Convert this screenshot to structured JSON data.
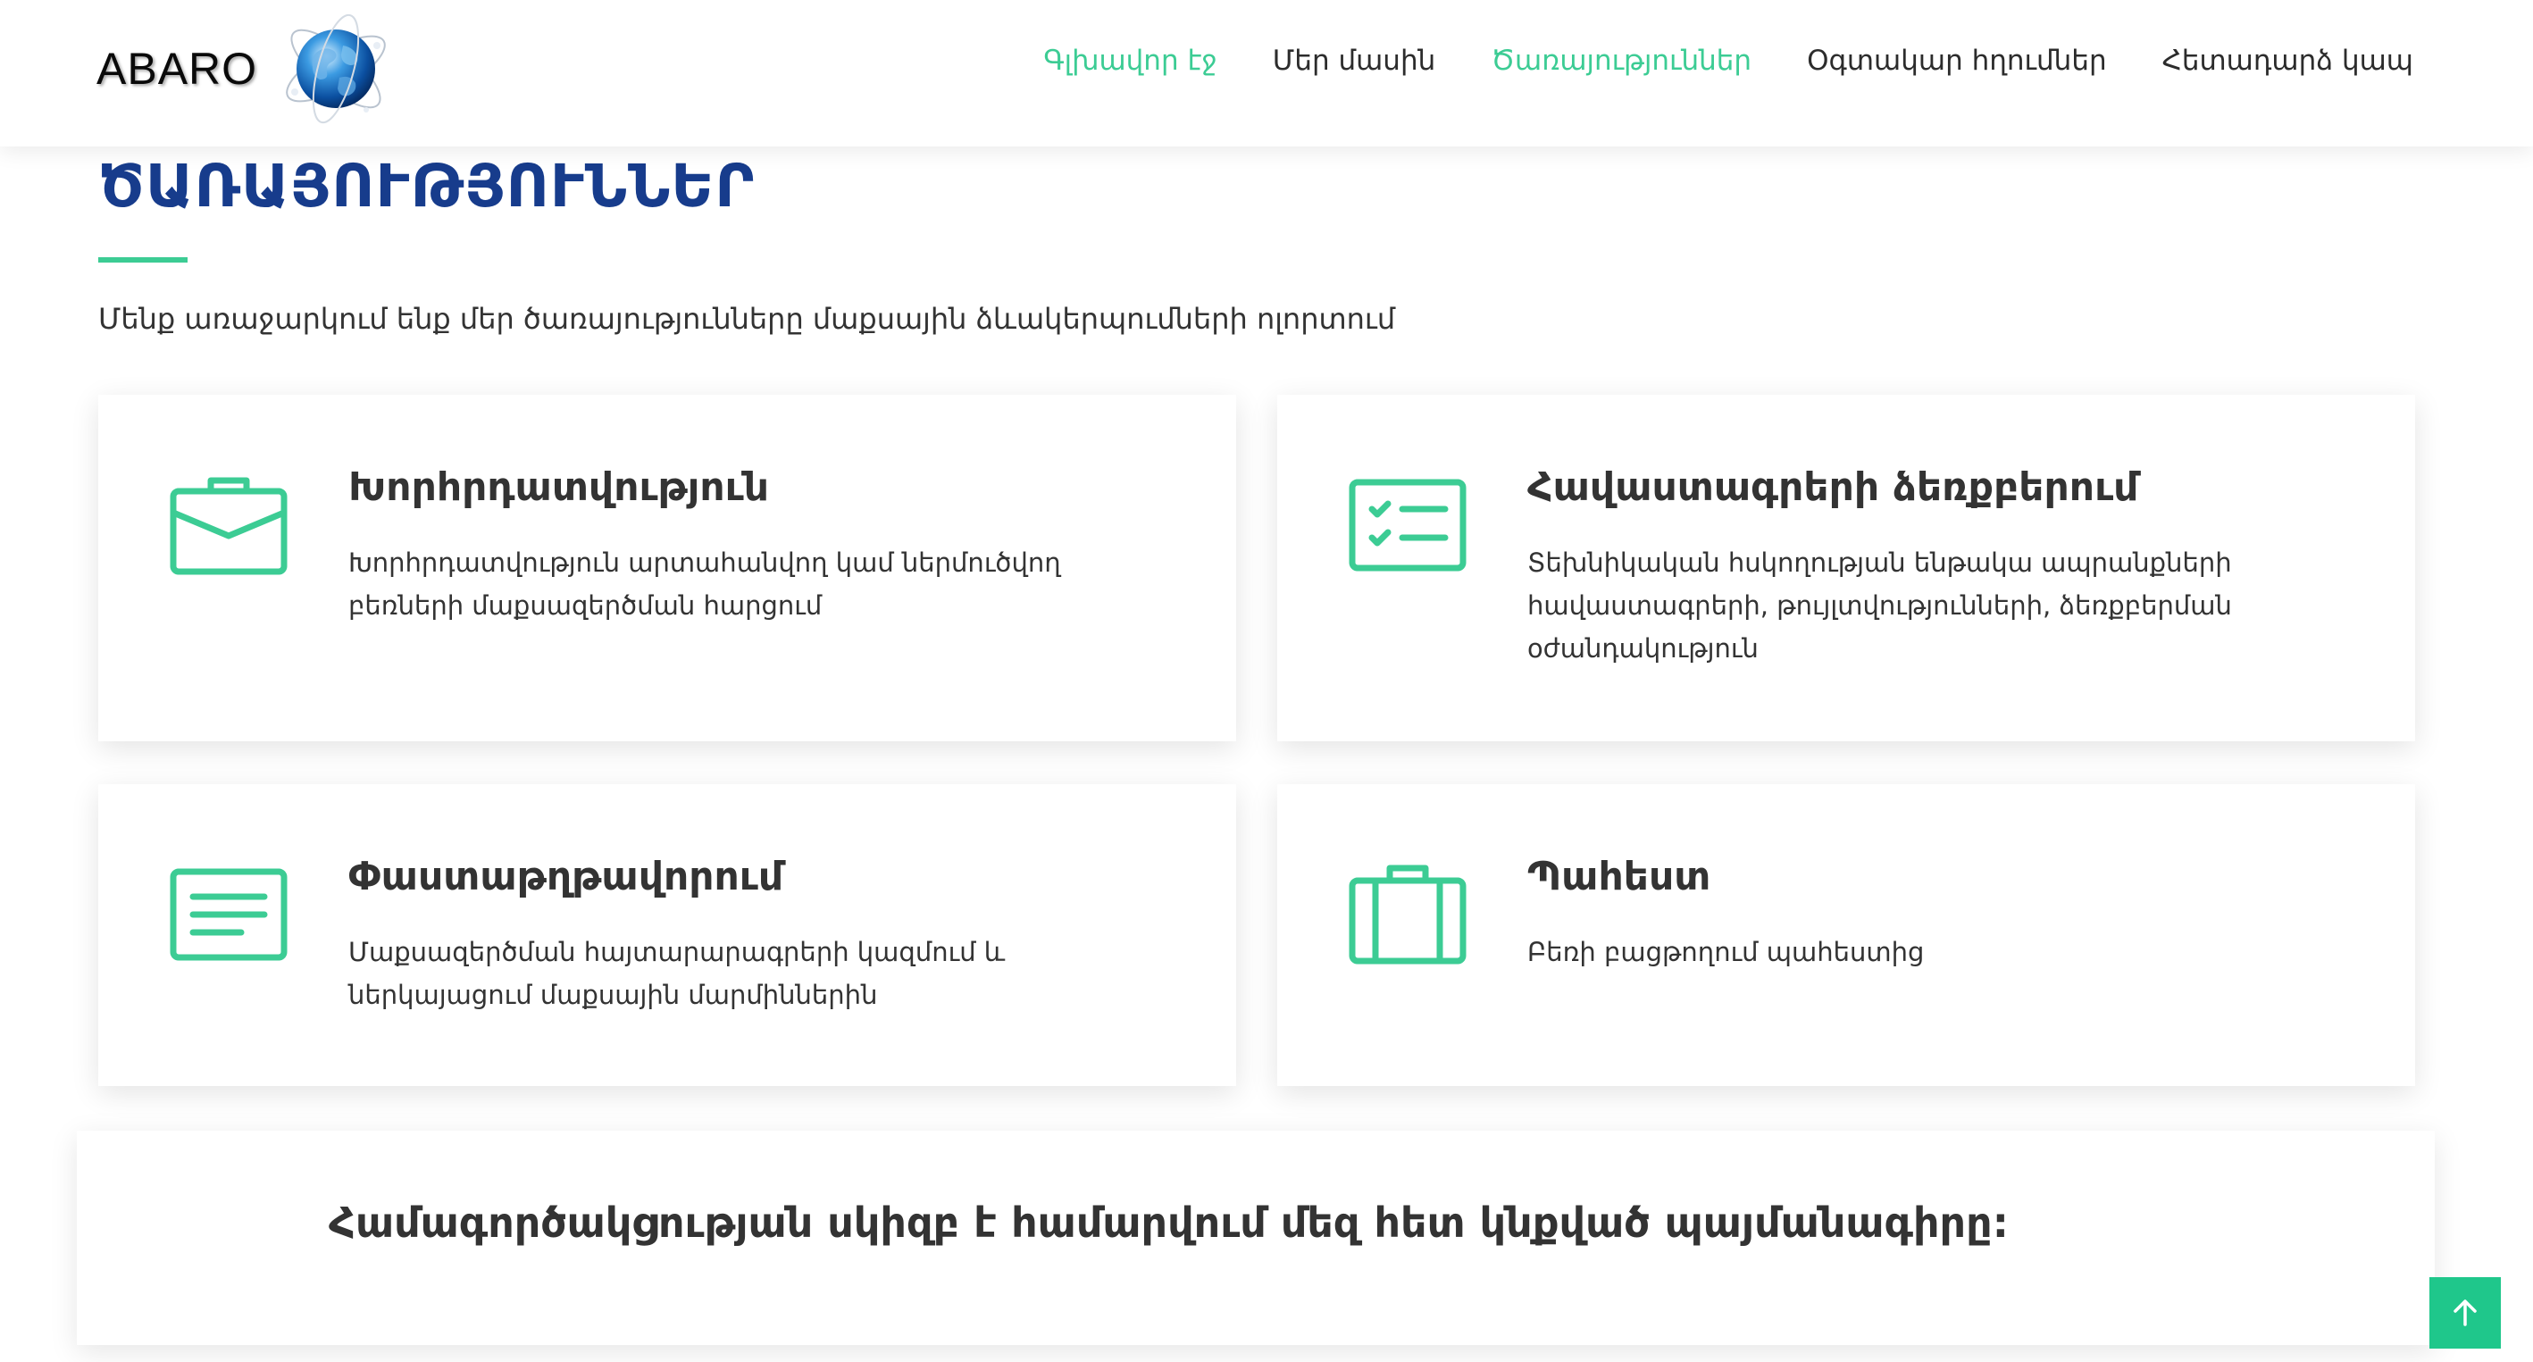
{
  "header": {
    "logo_text": "ABARO",
    "nav": [
      {
        "label": "Գլխավոր էջ",
        "active": false
      },
      {
        "label": "Մեր մասին",
        "active": false
      },
      {
        "label": "Ծառայություններ",
        "active": true
      },
      {
        "label": "Օգտակար հղումներ",
        "active": false
      },
      {
        "label": "Հետադարձ կապ",
        "active": false
      }
    ]
  },
  "section": {
    "title": "ԾԱՌԱՅՈՒԹՅՈՒՆՆԵՐ",
    "intro": "Մենք առաջարկում ենք մեր ծառայությունները մաքսային ձևակերպումների ոլորտում"
  },
  "services": [
    {
      "icon": "briefcase-icon",
      "title": "Խորհրդատվություն",
      "description": "Խորհրդատվություն արտահանվող կամ ներմուծվող բեռների մաքսազերծման հարցում"
    },
    {
      "icon": "checklist-icon",
      "title": "Հավաստագրերի ձեռքբերում",
      "description": "Տեխնիկական հսկողության ենթակա ապրանքների հավաստագրերի, թույլտվությունների, ձեռքբերման օժանդակություն"
    },
    {
      "icon": "document-icon",
      "title": "Փաստաթղթավորում",
      "description": "Մաքսազերծման հայտարարագրերի կազմում և ներկայացում մաքսային մարմիններին"
    },
    {
      "icon": "suitcase-icon",
      "title": "Պահեստ",
      "description": "Բեռի բացթողում պահեստից"
    }
  ],
  "banner": {
    "text": "Համագործակցության սկիզբ է համարվում մեզ հետ կնքված պայմանագիրը:"
  },
  "colors": {
    "accent": "#3ccc94",
    "title_blue": "#173c8c",
    "back_to_top": "#1fc78b"
  }
}
